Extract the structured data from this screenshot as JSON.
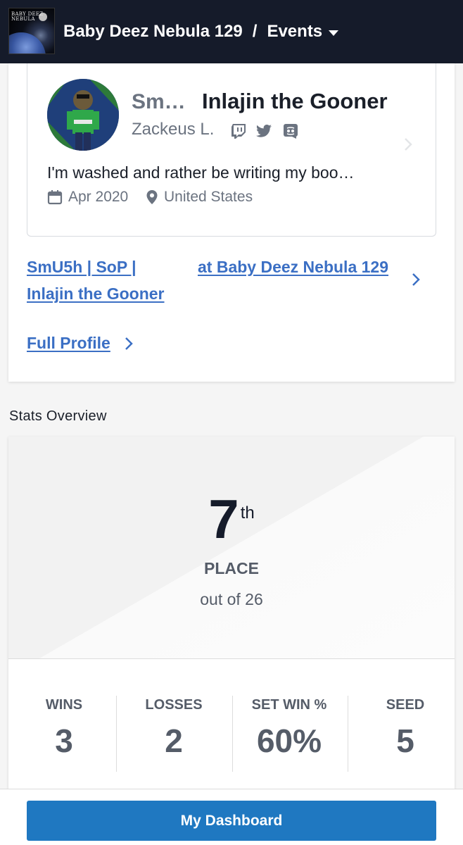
{
  "header": {
    "logo_text": "BABY DEEZ\nNEBULA",
    "tournament": "Baby Deez Nebula 129",
    "separator": "/",
    "section": "Events"
  },
  "profile": {
    "prefix": "Sm…",
    "gamer_tag": "Inlajin the Gooner",
    "real_name": "Zackeus L.",
    "socials": [
      "twitch-icon",
      "twitter-icon",
      "discord-icon"
    ],
    "bio": "I'm washed and rather be writing my boo…",
    "joined": "Apr 2020",
    "location": "United States"
  },
  "links": {
    "entrant_line1": "SmU5h | SoP |",
    "entrant_line2": "Inlajin the Gooner",
    "at_event": "at Baby Deez Nebula 129",
    "full_profile": "Full Profile"
  },
  "stats": {
    "title": "Stats Overview",
    "placement": "7",
    "placement_suffix": "th",
    "place_label": "PLACE",
    "out_of": "out of 26",
    "items": [
      {
        "label": "WINS",
        "value": "3"
      },
      {
        "label": "LOSSES",
        "value": "2"
      },
      {
        "label": "SET WIN %",
        "value": "60%"
      },
      {
        "label": "SEED",
        "value": "5"
      }
    ]
  },
  "footer": {
    "dashboard_label": "My Dashboard"
  },
  "colors": {
    "header_bg": "#151b2a",
    "link": "#3b6fc4",
    "button": "#1f78c1"
  }
}
